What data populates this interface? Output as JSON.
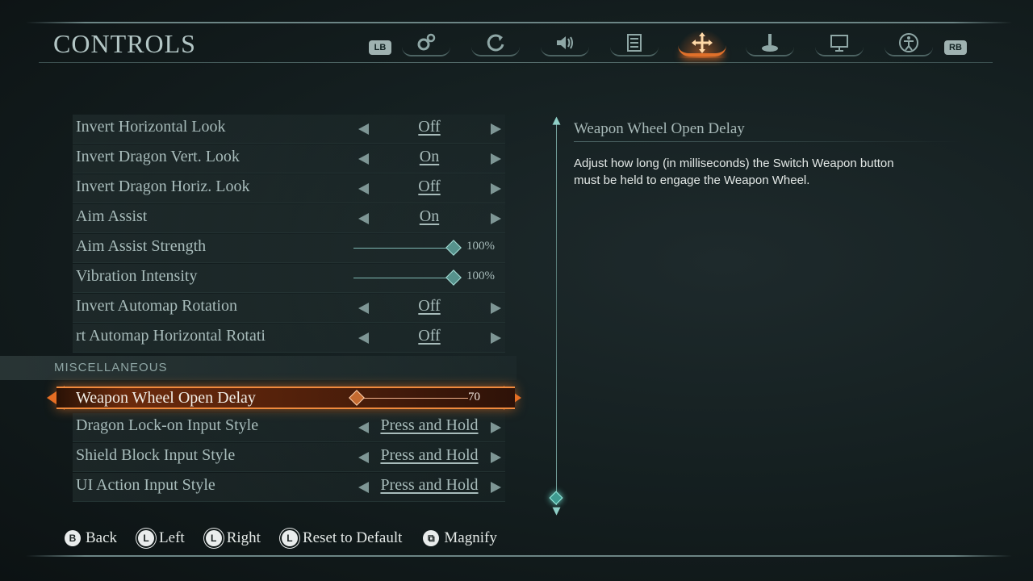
{
  "page": {
    "title": "CONTROLS"
  },
  "tabs": {
    "left_shoulder": "LB",
    "right_shoulder": "RB",
    "items": [
      {
        "icon": "gears-icon",
        "active": false
      },
      {
        "icon": "refresh-swirl-icon",
        "active": false
      },
      {
        "icon": "speaker-icon",
        "active": false
      },
      {
        "icon": "list-icon",
        "active": false
      },
      {
        "icon": "move-arrows-icon",
        "active": true
      },
      {
        "icon": "joystick-icon",
        "active": false
      },
      {
        "icon": "monitor-icon",
        "active": false
      },
      {
        "icon": "accessibility-icon",
        "active": false
      }
    ]
  },
  "settings": [
    {
      "label": "Invert Horizontal Look",
      "type": "toggle",
      "value": "Off"
    },
    {
      "label": "Invert Dragon Vert. Look",
      "type": "toggle",
      "value": "On"
    },
    {
      "label": "Invert Dragon Horiz. Look",
      "type": "toggle",
      "value": "Off"
    },
    {
      "label": "Aim Assist",
      "type": "toggle",
      "value": "On"
    },
    {
      "label": "Aim Assist Strength",
      "type": "slider",
      "value": "100%",
      "level": 1.0
    },
    {
      "label": "Vibration Intensity",
      "type": "slider",
      "value": "100%",
      "level": 1.0
    },
    {
      "label": "Invert Automap Rotation",
      "type": "toggle",
      "value": "Off"
    },
    {
      "label": "rt Automap Horizontal Rotati",
      "type": "toggle",
      "value": "Off"
    }
  ],
  "misc_section": {
    "label": "MISCELLANEOUS",
    "selected": {
      "label": "Weapon Wheel Open Delay",
      "type": "slider",
      "value": "70",
      "level": 0.0
    },
    "items": [
      {
        "label": "Dragon Lock-on Input Style",
        "type": "toggle",
        "value": "Press and Hold"
      },
      {
        "label": "Shield Block Input Style",
        "type": "toggle",
        "value": "Press and Hold"
      },
      {
        "label": "UI Action Input Style",
        "type": "toggle",
        "value": "Press and Hold"
      }
    ]
  },
  "detail": {
    "title": "Weapon Wheel Open Delay",
    "description": "Adjust how long (in milliseconds) the Switch Weapon button must be held to engage the Weapon Wheel."
  },
  "footer": {
    "hints": [
      {
        "glyph": "B",
        "label": "Back"
      },
      {
        "glyph": "L",
        "label": "Left"
      },
      {
        "glyph": "L",
        "label": "Right"
      },
      {
        "glyph": "L",
        "label": "Reset to Default"
      },
      {
        "glyph": "⧉",
        "label": "Magnify"
      }
    ]
  },
  "colors": {
    "accent": "#e0702a",
    "teal": "#7fb9b3",
    "text": "#a8bcbb"
  }
}
